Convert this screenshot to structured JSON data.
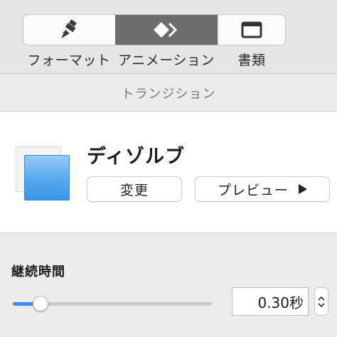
{
  "toolbar": {
    "tabs": [
      {
        "label": "フォーマット",
        "icon": "paintbrush-icon",
        "selected": false
      },
      {
        "label": "アニメーション",
        "icon": "animation-diamond-icon",
        "selected": true
      },
      {
        "label": "書類",
        "icon": "document-icon",
        "selected": false
      }
    ]
  },
  "section": {
    "title": "トランジション"
  },
  "effect": {
    "name": "ディゾルブ",
    "thumbnail_icon": "dissolve-thumbnail-icon",
    "change_label": "変更",
    "preview_label": "プレビュー"
  },
  "duration": {
    "label": "継続時間",
    "value": "0.30秒",
    "slider_fraction": 0.09
  },
  "colors": {
    "selected_tab": "#6d6d6d",
    "accent": "#3d8ef0",
    "thumbnail_blue": "#4aa3ee"
  }
}
